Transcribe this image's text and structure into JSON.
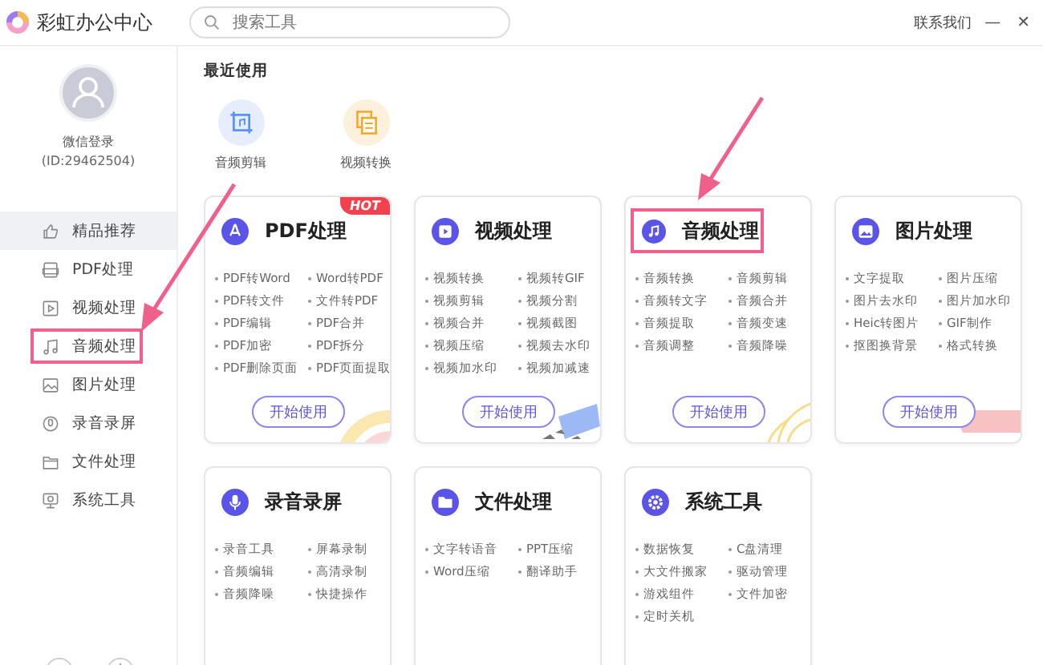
{
  "app": {
    "title": "彩虹办公中心",
    "contact": "联系我们",
    "minimize": "—",
    "close": "✕"
  },
  "search": {
    "placeholder": "搜索工具"
  },
  "profile": {
    "name": "微信登录",
    "id": "(ID:29462504)"
  },
  "sidebar": {
    "items": [
      {
        "label": "精品推荐",
        "selected": true,
        "annotated": false
      },
      {
        "label": "PDF处理",
        "selected": false,
        "annotated": false
      },
      {
        "label": "视频处理",
        "selected": false,
        "annotated": false
      },
      {
        "label": "音频处理",
        "selected": false,
        "annotated": true
      },
      {
        "label": "图片处理",
        "selected": false,
        "annotated": false
      },
      {
        "label": "录音录屏",
        "selected": false,
        "annotated": false
      },
      {
        "label": "文件处理",
        "selected": false,
        "annotated": false
      },
      {
        "label": "系统工具",
        "selected": false,
        "annotated": false
      }
    ]
  },
  "recent": {
    "title": "最近使用",
    "items": [
      {
        "label": "音频剪辑"
      },
      {
        "label": "视频转换"
      }
    ]
  },
  "cards": [
    {
      "title": "PDF处理",
      "badge": "HOT",
      "annotated": false,
      "button": "开始使用",
      "tools": [
        "PDF转Word",
        "Word转PDF",
        "PDF转文件",
        "文件转PDF",
        "PDF编辑",
        "PDF合并",
        "PDF加密",
        "PDF拆分",
        "PDF删除页面",
        "PDF页面提取"
      ]
    },
    {
      "title": "视频处理",
      "annotated": false,
      "button": "开始使用",
      "tools": [
        "视频转换",
        "视频转GIF",
        "视频剪辑",
        "视频分割",
        "视频合并",
        "视频截图",
        "视频压缩",
        "视频去水印",
        "视频加水印",
        "视频加减速"
      ]
    },
    {
      "title": "音频处理",
      "annotated": true,
      "button": "开始使用",
      "tools": [
        "音频转换",
        "音频剪辑",
        "音频转文字",
        "音频合并",
        "音频提取",
        "音频变速",
        "音频调整",
        "音频降噪"
      ]
    },
    {
      "title": "图片处理",
      "annotated": false,
      "button": "开始使用",
      "tools": [
        "文字提取",
        "图片压缩",
        "图片去水印",
        "图片加水印",
        "Heic转图片",
        "GIF制作",
        "抠图换背景",
        "格式转换"
      ]
    },
    {
      "title": "录音录屏",
      "annotated": false,
      "tools": [
        "录音工具",
        "屏幕录制",
        "音频编辑",
        "高清录制",
        "音频降噪",
        "快捷操作"
      ]
    },
    {
      "title": "文件处理",
      "annotated": false,
      "tools": [
        "文字转语音",
        "PPT压缩",
        "Word压缩",
        "翻译助手"
      ]
    },
    {
      "title": "系统工具",
      "annotated": false,
      "tools": [
        "数据恢复",
        "C盘清理",
        "大文件搬家",
        "驱动管理",
        "游戏组件",
        "文件加密",
        "定时关机"
      ]
    }
  ]
}
